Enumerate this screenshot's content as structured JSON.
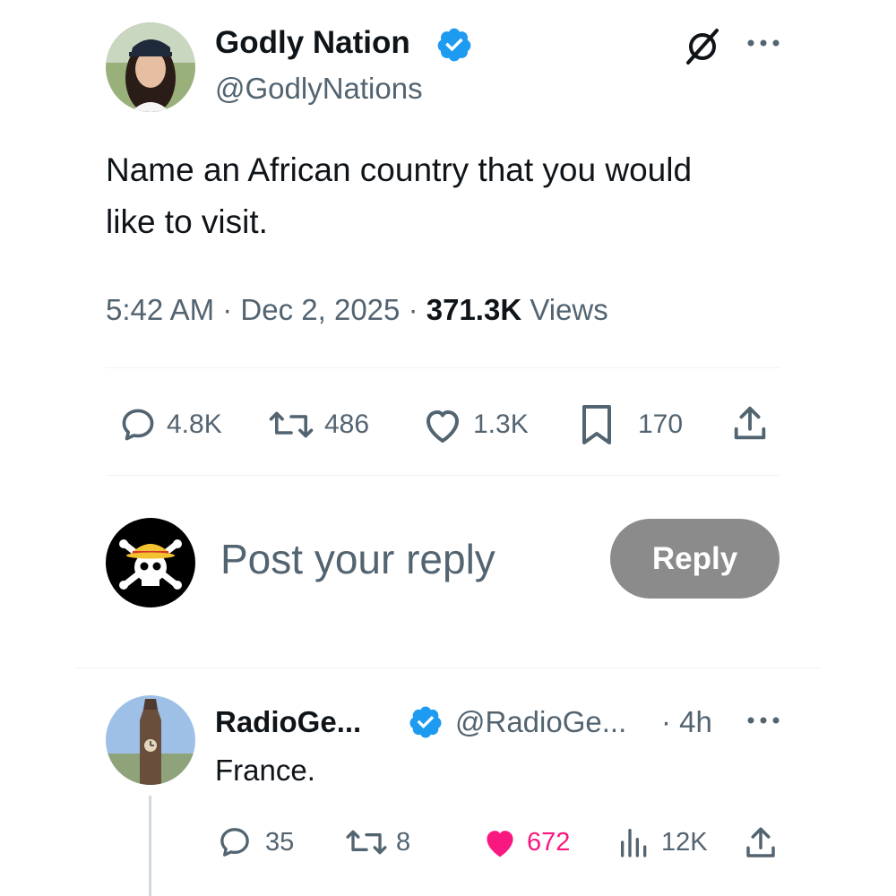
{
  "tweet": {
    "author": {
      "display_name": "Godly Nation",
      "handle": "@GodlyNations",
      "verified": true,
      "avatar_icon": "profile-photo-woman-cap"
    },
    "text": "Name an African country that you would like to visit.",
    "time": "5:42 AM",
    "separator": "·",
    "date": "Dec 2, 2025",
    "views_count": "371.3K",
    "views_label": "Views",
    "stats": {
      "replies": "4.8K",
      "reposts": "486",
      "likes": "1.3K",
      "bookmarks": "170"
    }
  },
  "composer": {
    "placeholder": "Post your reply",
    "button_label": "Reply",
    "avatar_icon": "straw-hat-jolly-roger"
  },
  "reply": {
    "author": {
      "display_name": "RadioGe...",
      "handle": "@RadioGe...",
      "verified": true,
      "avatar_icon": "clock-tower-photo"
    },
    "age": "· 4h",
    "text": "France.",
    "stats": {
      "replies": "35",
      "reposts": "8",
      "likes": "672",
      "views": "12K"
    }
  },
  "colors": {
    "verified": "#1d9bf0",
    "like_active": "#f91880",
    "secondary_text": "#536471",
    "reply_button_disabled": "#8b8b8b"
  }
}
